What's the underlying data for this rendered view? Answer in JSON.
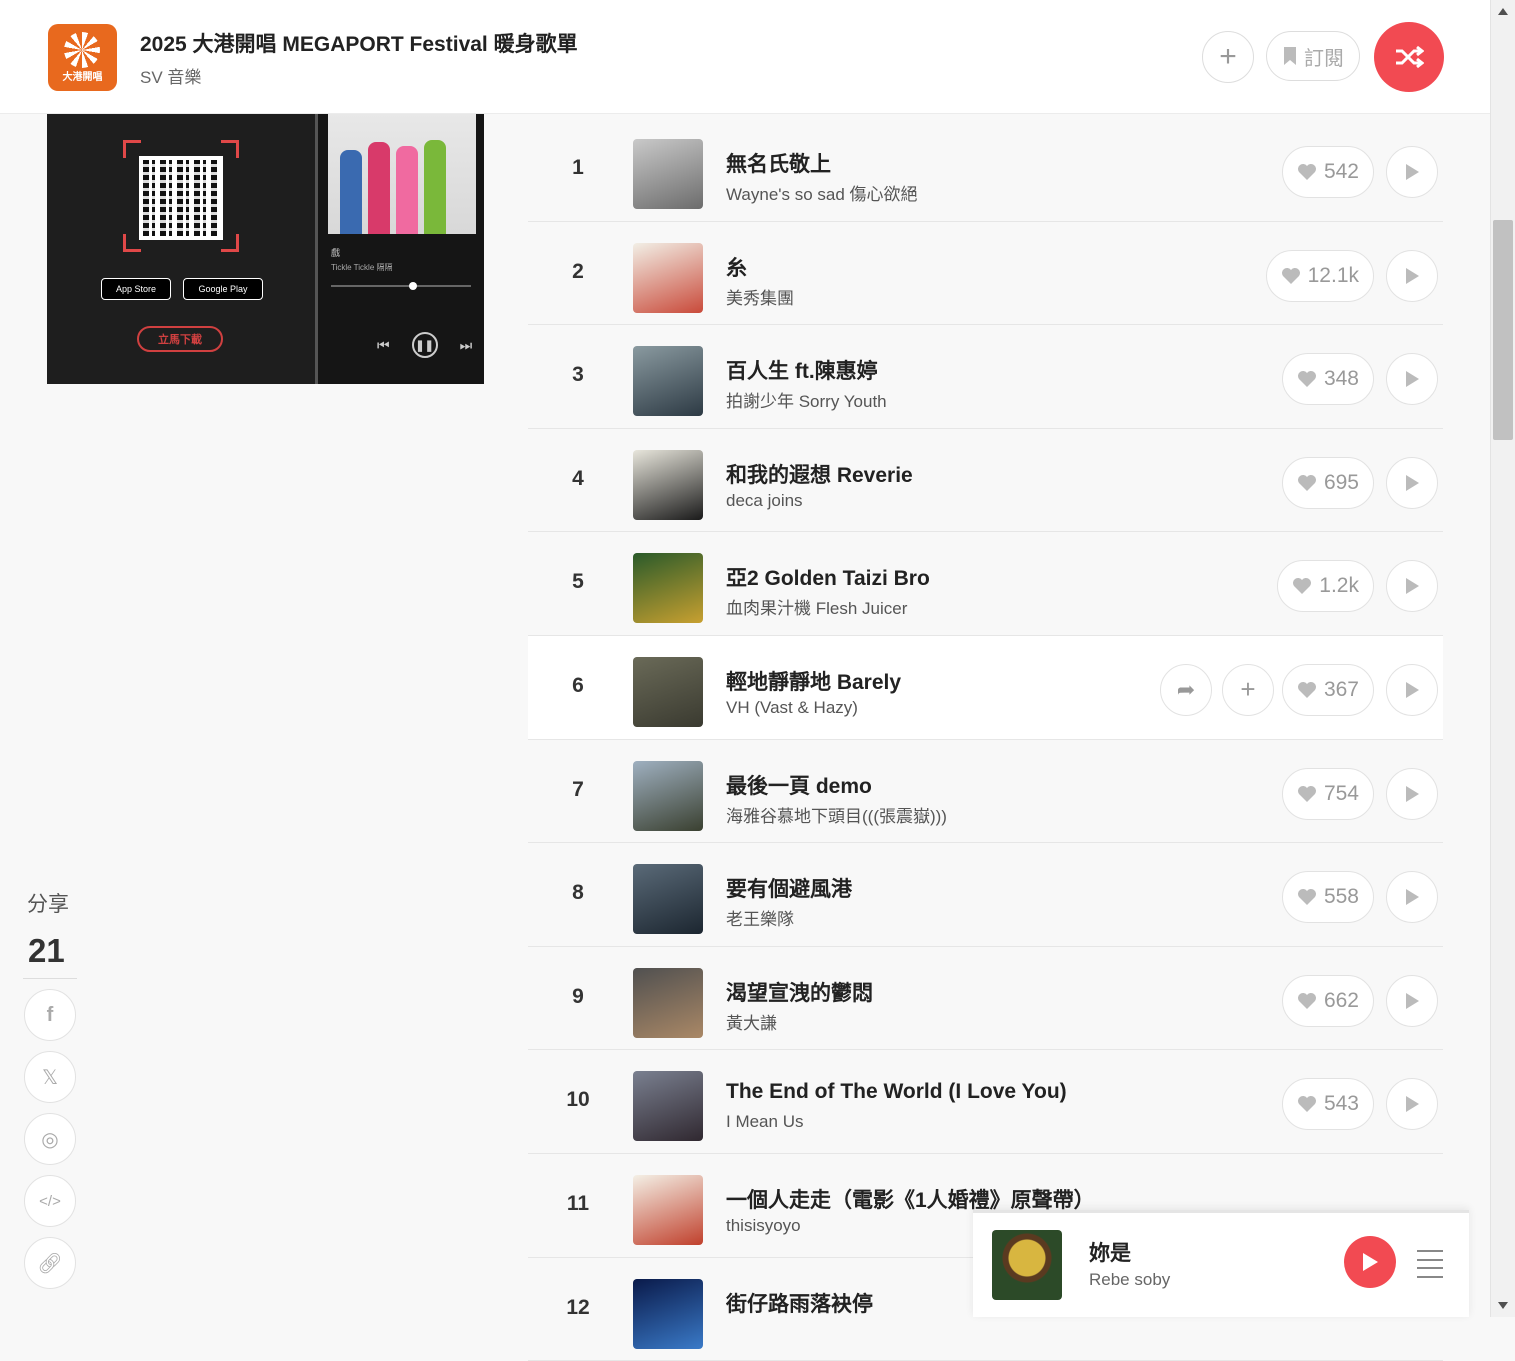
{
  "playlist": {
    "logo_text": "大港開唱",
    "title": "2025 大港開唱 MEGAPORT Festival 暖身歌單",
    "owner": "SV 音樂",
    "subscribe_label": "訂閱"
  },
  "promo": {
    "app_store": "App Store",
    "google_play": "Google Play",
    "download_label": "立馬下載",
    "track_name": "戲",
    "track_artist": "Tickle Tickle 隔隔"
  },
  "share": {
    "label": "分享",
    "count": "21"
  },
  "songs": [
    {
      "rank": "1",
      "title": "無名氏敬上",
      "artist": "Wayne's so sad 傷心欲絕",
      "likes": "542",
      "cover": [
        "#c9c9c9",
        "#6c6c6c"
      ]
    },
    {
      "rank": "2",
      "title": "糸",
      "artist": "美秀集團",
      "likes": "12.1k",
      "cover": [
        "#f2efe6",
        "#c94a3a"
      ]
    },
    {
      "rank": "3",
      "title": "百人生 ft.陳惠婷",
      "artist": "拍謝少年 Sorry Youth",
      "likes": "348",
      "cover": [
        "#8a9aa0",
        "#2d3a44"
      ]
    },
    {
      "rank": "4",
      "title": "和我的遐想 Reverie",
      "artist": "deca joins",
      "likes": "695",
      "cover": [
        "#e8e6dc",
        "#1a1a1a"
      ]
    },
    {
      "rank": "5",
      "title": "亞2 Golden Taizi Bro",
      "artist": "血肉果汁機 Flesh Juicer",
      "likes": "1.2k",
      "cover": [
        "#2a5a2a",
        "#c8a030"
      ]
    },
    {
      "rank": "6",
      "title": "輕地靜靜地 Barely",
      "artist": "VH (Vast & Hazy)",
      "likes": "367",
      "cover": [
        "#6a6a58",
        "#3a3a30"
      ]
    },
    {
      "rank": "7",
      "title": "最後一頁 demo",
      "artist": "海雅谷慕地下頭目(((張震嶽)))",
      "likes": "754",
      "cover": [
        "#9fb0c0",
        "#3a4030"
      ]
    },
    {
      "rank": "8",
      "title": "要有個避風港",
      "artist": "老王樂隊",
      "likes": "558",
      "cover": [
        "#5a6a78",
        "#1c2630"
      ]
    },
    {
      "rank": "9",
      "title": "渴望宣洩的鬱悶",
      "artist": "黃大謙",
      "likes": "662",
      "cover": [
        "#505050",
        "#aa8866"
      ]
    },
    {
      "rank": "10",
      "title": "The End of The World (I Love You)",
      "artist": "I Mean Us",
      "likes": "543",
      "cover": [
        "#7a8090",
        "#302830"
      ]
    },
    {
      "rank": "11",
      "title": "一個人走走（電影《1人婚禮》原聲帶）",
      "artist": "thisisyoyo",
      "likes": "",
      "cover": [
        "#f4f0e6",
        "#c0402c"
      ]
    },
    {
      "rank": "12",
      "title": "街仔路雨落袂停",
      "artist": "",
      "likes": "",
      "cover": [
        "#0a1a4a",
        "#3a7ac8"
      ]
    }
  ],
  "player": {
    "title": "妳是",
    "artist": "Rebe soby"
  },
  "colors": {
    "accent": "#f24a52",
    "promo_bg": "#2a2a2a",
    "logo": "#e8691e"
  },
  "icons": {
    "add": "plus-icon",
    "subscribe": "bookmark-icon",
    "shuffle": "shuffle-icon",
    "like": "heart-icon",
    "play": "play-icon",
    "share_row": "share-arrow-icon",
    "facebook": "facebook-icon",
    "x": "x-icon",
    "weibo": "weibo-icon",
    "embed": "code-icon",
    "link": "link-icon",
    "queue": "menu-icon"
  }
}
